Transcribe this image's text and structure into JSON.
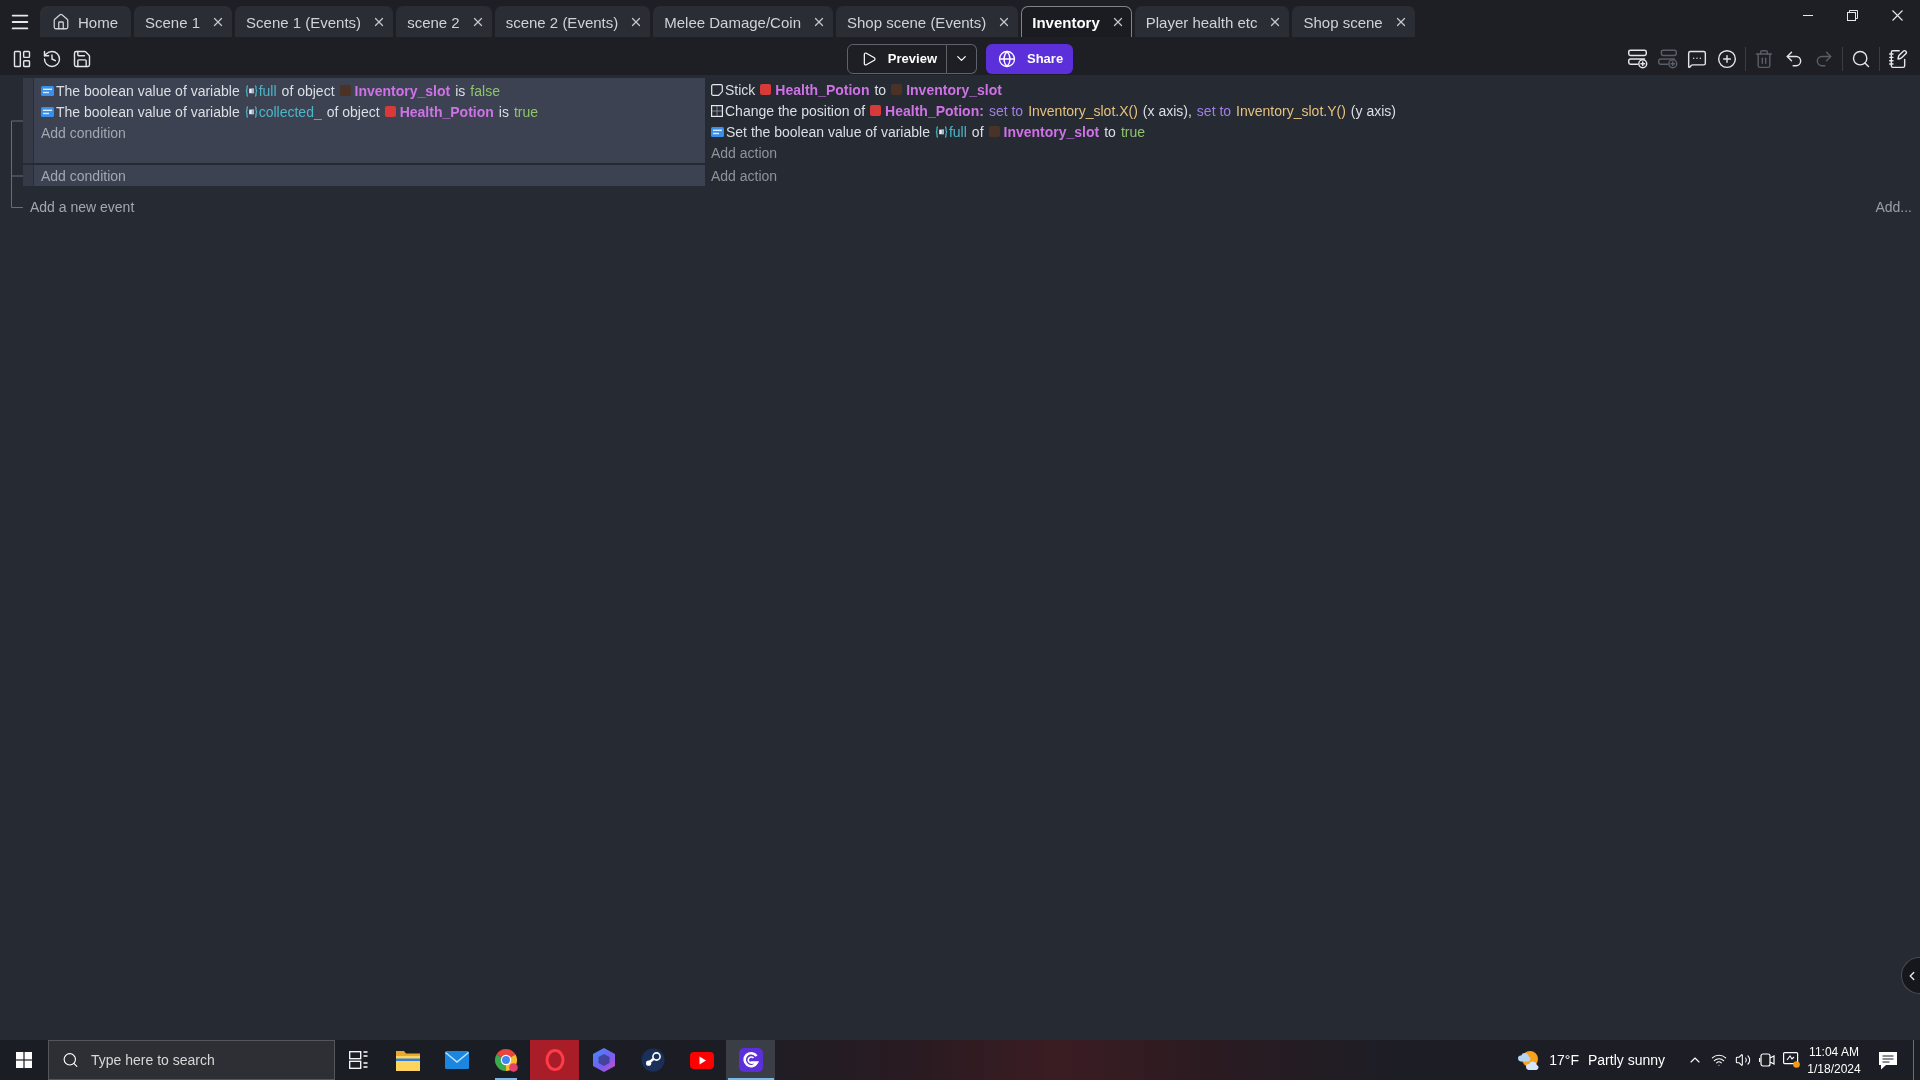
{
  "tabs": [
    {
      "kind": "home",
      "label": "Home",
      "selected": false
    },
    {
      "kind": "editor",
      "label": "Scene 1",
      "selected": false
    },
    {
      "kind": "editor",
      "label": "Scene 1 (Events)",
      "selected": false
    },
    {
      "kind": "editor",
      "label": "scene 2",
      "selected": false
    },
    {
      "kind": "editor",
      "label": "scene 2 (Events)",
      "selected": false
    },
    {
      "kind": "editor",
      "label": "Melee Damage/Coin",
      "selected": false
    },
    {
      "kind": "editor",
      "label": "Shop scene (Events)",
      "selected": false
    },
    {
      "kind": "editor",
      "label": "Inventory",
      "selected": true
    },
    {
      "kind": "editor",
      "label": "Player health etc",
      "selected": false
    },
    {
      "kind": "editor",
      "label": "Shop scene",
      "selected": false
    }
  ],
  "toolbar": {
    "preview": "Preview",
    "share": "Share",
    "tools": [
      {
        "disabled": false
      },
      {
        "disabled": false
      },
      {
        "disabled": false
      },
      {
        "disabled": false
      },
      {
        "disabled": true
      },
      {
        "disabled": false
      },
      {
        "disabled": false
      },
      {
        "disabled": true
      },
      {
        "disabled": false
      },
      {
        "disabled": true
      },
      {
        "disabled": false
      },
      {
        "disabled": false
      }
    ]
  },
  "events": [
    {
      "conditions": [
        {
          "kind": "variable",
          "parts": [
            {
              "kind": "text",
              "text": "The boolean value of variable"
            },
            {
              "kind": "variable",
              "text": "full"
            },
            {
              "kind": "text",
              "text": "of object"
            },
            {
              "kind": "object",
              "text": "Inventory_slot",
              "color": "#4a3326"
            },
            {
              "kind": "text",
              "text": "is"
            },
            {
              "kind": "value",
              "text": "false"
            }
          ]
        },
        {
          "kind": "variable",
          "parts": [
            {
              "kind": "text",
              "text": "The boolean value of variable"
            },
            {
              "kind": "variable",
              "text": "collected_"
            },
            {
              "kind": "text",
              "text": "of object"
            },
            {
              "kind": "object",
              "text": "Health_Potion",
              "color": "#d83a3a"
            },
            {
              "kind": "text",
              "text": "is"
            },
            {
              "kind": "value",
              "text": "true"
            }
          ]
        }
      ],
      "add_condition": "Add condition",
      "actions": [
        {
          "kind": "stick",
          "parts": [
            {
              "kind": "text",
              "text": "Stick"
            },
            {
              "kind": "object",
              "text": "Health_Potion",
              "color": "#d83a3a"
            },
            {
              "kind": "text",
              "text": "to"
            },
            {
              "kind": "object",
              "text": "Inventory_slot",
              "color": "#4a3326"
            }
          ]
        },
        {
          "kind": "position",
          "parts": [
            {
              "kind": "text",
              "text": "Change the position of"
            },
            {
              "kind": "object",
              "text": "Health_Potion:",
              "color": "#d83a3a"
            },
            {
              "kind": "keyword",
              "text": "set to"
            },
            {
              "kind": "expression",
              "text": "Inventory_slot.X()"
            },
            {
              "kind": "text",
              "text": "(x axis),"
            },
            {
              "kind": "keyword",
              "text": "set to"
            },
            {
              "kind": "expression",
              "text": "Inventory_slot.Y()"
            },
            {
              "kind": "text",
              "text": "(y axis)"
            }
          ]
        },
        {
          "kind": "variable",
          "parts": [
            {
              "kind": "text",
              "text": "Set the boolean value of variable"
            },
            {
              "kind": "variable",
              "text": "full"
            },
            {
              "kind": "text",
              "text": "of"
            },
            {
              "kind": "object",
              "text": "Inventory_slot",
              "color": "#4a3326"
            },
            {
              "kind": "text",
              "text": "to"
            },
            {
              "kind": "value",
              "text": "true"
            }
          ]
        }
      ],
      "add_action": "Add action"
    },
    {
      "add_condition": "Add condition",
      "add_action": "Add action"
    }
  ],
  "add_event": "Add a new event",
  "add_menu": "Add...",
  "taskbar": {
    "search": {
      "placeholder": "Type here to search"
    },
    "apps": [
      {
        "running": false,
        "selected": false,
        "attention": false
      },
      {
        "running": false,
        "selected": false,
        "attention": false
      },
      {
        "running": true,
        "selected": false,
        "attention": false
      },
      {
        "running": false,
        "selected": false,
        "attention": true
      },
      {
        "running": false,
        "selected": false,
        "attention": false
      },
      {
        "running": false,
        "selected": false,
        "attention": false
      },
      {
        "running": false,
        "selected": false,
        "attention": false
      },
      {
        "running": true,
        "selected": true,
        "attention": false
      }
    ],
    "weather": {
      "temperature": "17°F",
      "condition": "Partly sunny"
    },
    "clock": {
      "time": "11:04 AM",
      "date": "1/18/2024"
    }
  }
}
